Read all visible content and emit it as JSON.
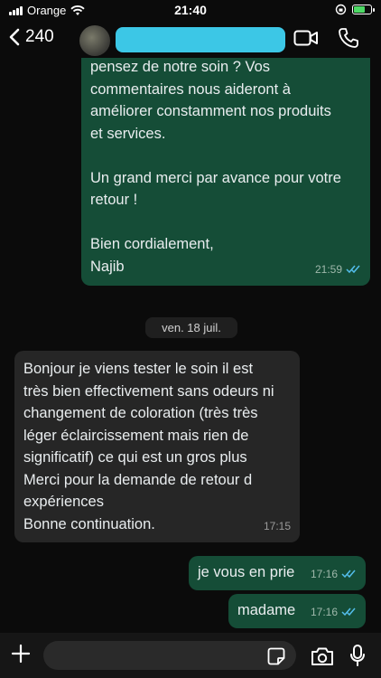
{
  "status": {
    "carrier": "Orange",
    "time": "21:40"
  },
  "header": {
    "back_count": "240"
  },
  "messages": [
    {
      "direction": "out",
      "text": "pensez de notre soin ? Vos\ncommentaires nous aideront à\naméliorer constamment nos produits\net services.\n\nUn grand merci par avance pour votre\nretour !\n\nBien cordialement,\nNajib",
      "time": "21:59",
      "read": true
    },
    {
      "direction": "in",
      "text": "Bonjour je viens tester le soin il est\ntrès bien effectivement sans odeurs ni\nchangement de coloration (très très\nléger éclaircissement mais rien de\nsignificatif) ce qui est un gros plus\nMerci pour la demande de retour d\nexpériences\nBonne continuation.",
      "time": "17:15"
    },
    {
      "direction": "out",
      "text": "je vous en prie",
      "time": "17:16",
      "read": true
    },
    {
      "direction": "out",
      "text": "madame",
      "time": "17:16",
      "read": true
    }
  ],
  "date_separator": "ven. 18 juil.",
  "colors": {
    "outgoing_bubble": "#154d37",
    "incoming_bubble": "#262626",
    "read_ticks": "#53bdeb",
    "redaction": "#3cc7e6"
  },
  "icons": [
    "back-chevron-icon",
    "video-call-icon",
    "phone-icon",
    "plus-icon",
    "sticker-icon",
    "camera-icon",
    "mic-icon",
    "wifi-icon",
    "battery-icon"
  ]
}
